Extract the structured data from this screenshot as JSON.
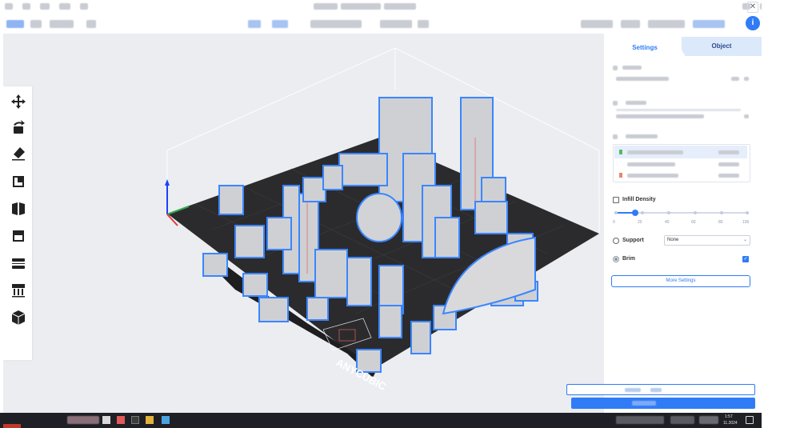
{
  "toolbar": {
    "info_label": "i"
  },
  "window": {
    "close_glyph": "✕"
  },
  "panel": {
    "tabs": [
      {
        "label": "Settings"
      },
      {
        "label": "Object"
      }
    ],
    "infill": {
      "label": "Infill Density",
      "value_percent": 15,
      "ticks": [
        "0",
        "20",
        "40",
        "60",
        "80",
        "100"
      ]
    },
    "support": {
      "label": "Support",
      "selected": "None"
    },
    "brim": {
      "label": "Brim",
      "checked": true
    },
    "more_settings": "More Settings"
  },
  "viewport": {
    "brand": "ANYCUBIC"
  },
  "taskbar": {
    "time": "1:57",
    "date": "11.2024",
    "notif_count": "1"
  },
  "colors": {
    "accent": "#2f7cf6",
    "model_edge": "#3a86ff",
    "plate": "#2b2b2e",
    "model": "#cfd0d3"
  },
  "icons": [
    "move-icon",
    "rotate-icon",
    "paint-icon",
    "scale-icon",
    "mirror-icon",
    "cut-icon",
    "layers-icon",
    "support-paint-icon",
    "cube-icon"
  ]
}
